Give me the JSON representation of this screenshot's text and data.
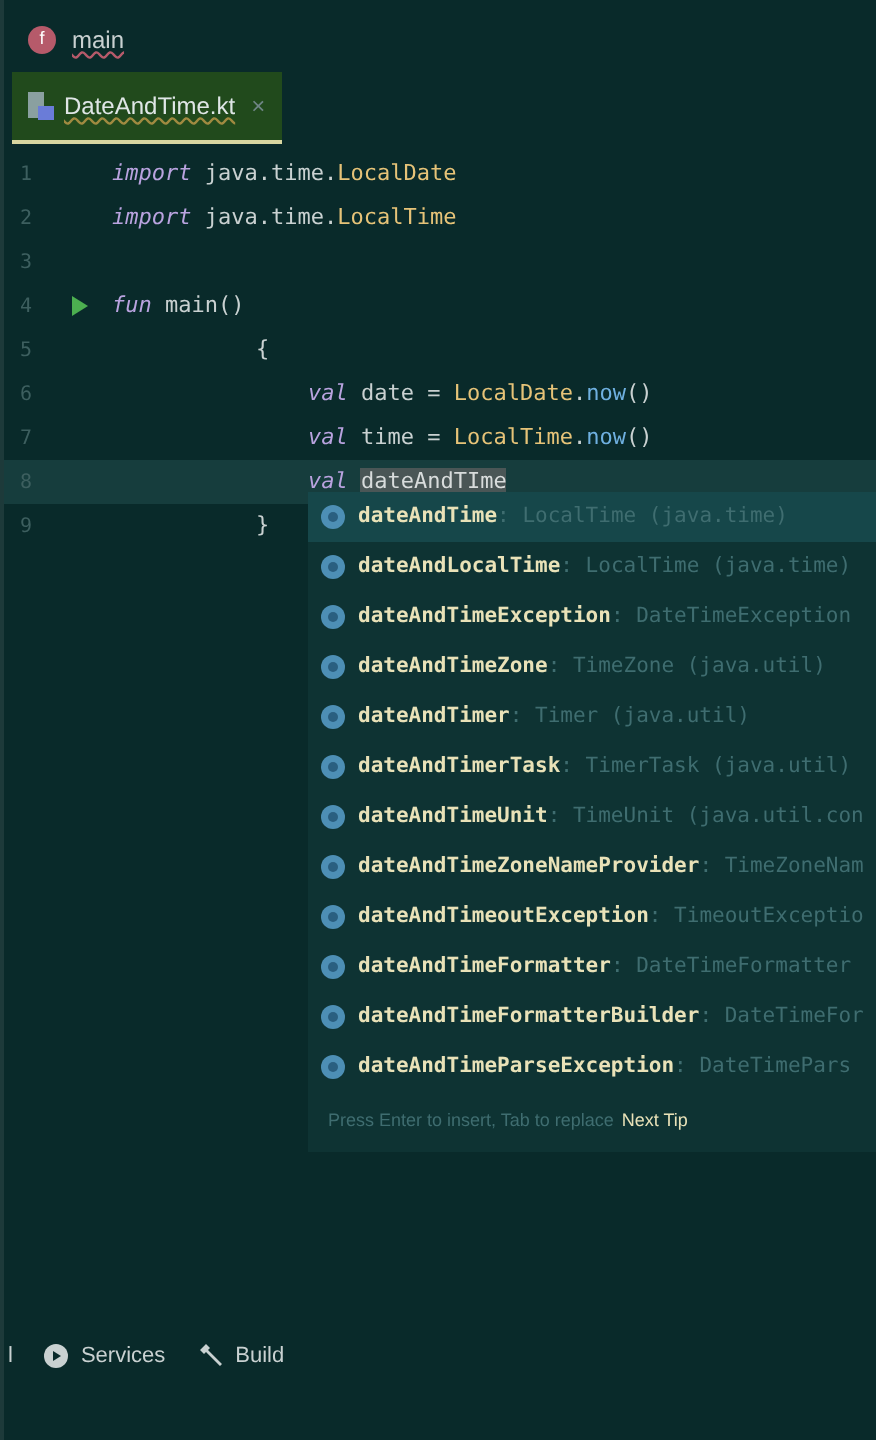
{
  "breadcrumb": {
    "icon_letter": "f",
    "label": "main"
  },
  "tabs": [
    {
      "label": "DateAndTime.kt",
      "close": "×",
      "selected": true
    }
  ],
  "code_lines": [
    {
      "number": "1",
      "kind": "top",
      "tokens": [
        {
          "kind": "keyword",
          "text": "import"
        },
        {
          "kind": "plain",
          "text": " java.time."
        },
        {
          "kind": "class",
          "text": "LocalDate"
        }
      ]
    },
    {
      "number": "2",
      "kind": "top",
      "tokens": [
        {
          "kind": "keyword",
          "text": "import"
        },
        {
          "kind": "plain",
          "text": " java.time."
        },
        {
          "kind": "class",
          "text": "LocalTime"
        }
      ]
    },
    {
      "number": "3"
    },
    {
      "number": "4",
      "kind": "top",
      "run": true,
      "tokens": [
        {
          "kind": "keyword",
          "text": "fun"
        },
        {
          "kind": "plain",
          "text": " main()"
        }
      ]
    },
    {
      "number": "5",
      "kind": "brace",
      "tokens": [
        {
          "kind": "plain",
          "text": "{"
        }
      ]
    },
    {
      "number": "6",
      "kind": "body",
      "tokens": [
        {
          "kind": "keyword",
          "text": "val"
        },
        {
          "kind": "plain",
          "text": " date = "
        },
        {
          "kind": "class",
          "text": "LocalDate"
        },
        {
          "kind": "plain",
          "text": "."
        },
        {
          "kind": "method",
          "text": "now"
        },
        {
          "kind": "plain",
          "text": "()"
        }
      ]
    },
    {
      "number": "7",
      "kind": "body",
      "tokens": [
        {
          "kind": "keyword",
          "text": "val"
        },
        {
          "kind": "plain",
          "text": " time = "
        },
        {
          "kind": "class",
          "text": "LocalTime"
        },
        {
          "kind": "plain",
          "text": "."
        },
        {
          "kind": "method",
          "text": "now"
        },
        {
          "kind": "plain",
          "text": "()"
        }
      ]
    },
    {
      "number": "8",
      "kind": "body",
      "current": true,
      "tokens": [
        {
          "kind": "keyword",
          "text": "val"
        },
        {
          "kind": "selection",
          "text": "dateAndTIme"
        }
      ]
    },
    {
      "number": "9",
      "kind": "brace",
      "tokens": [
        {
          "kind": "plain",
          "text": "}"
        }
      ]
    }
  ],
  "completion": {
    "items": [
      {
        "name": "dateAndTime",
        "type": ": LocalTime (java.time)",
        "selected": true
      },
      {
        "name": "dateAndLocalTime",
        "type": ": LocalTime (java.time)",
        "selected": false
      },
      {
        "name": "dateAndTimeException",
        "type": ": DateTimeException",
        "selected": false
      },
      {
        "name": "dateAndTimeZone",
        "type": ": TimeZone (java.util)",
        "selected": false
      },
      {
        "name": "dateAndTimer",
        "type": ": Timer (java.util)",
        "selected": false
      },
      {
        "name": "dateAndTimerTask",
        "type": ": TimerTask (java.util)",
        "selected": false
      },
      {
        "name": "dateAndTimeUnit",
        "type": ": TimeUnit (java.util.con",
        "selected": false
      },
      {
        "name": "dateAndTimeZoneNameProvider",
        "type": ": TimeZoneNam",
        "selected": false
      },
      {
        "name": "dateAndTimeoutException",
        "type": ": TimeoutExceptio",
        "selected": false
      },
      {
        "name": "dateAndTimeFormatter",
        "type": ": DateTimeFormatter",
        "selected": false
      },
      {
        "name": "dateAndTimeFormatterBuilder",
        "type": ": DateTimeFor",
        "selected": false
      },
      {
        "name": "dateAndTimeParseException",
        "type": ": DateTimePars",
        "selected": false
      }
    ],
    "hint": "Press Enter to insert, Tab to replace",
    "hint_link": "Next Tip"
  },
  "bottom_bar": [
    {
      "kind": "cut",
      "label": "l"
    },
    {
      "kind": "services",
      "label": "Services"
    },
    {
      "kind": "build",
      "label": "Build"
    }
  ]
}
